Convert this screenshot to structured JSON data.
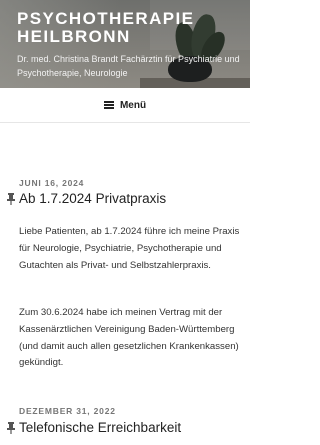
{
  "site": {
    "title": "PSYCHOTHERAPIE HEILBRONN",
    "description": "Dr. med. Christina Brandt Fachärztin für Psychiatrie und Psychotherapie, Neurologie"
  },
  "nav": {
    "menu_label": "Menü"
  },
  "posts": [
    {
      "date": "JUNI 16, 2024",
      "title": "Ab 1.7.2024 Privatpraxis",
      "paragraphs": [
        "Liebe Patienten, ab 1.7.2024 führe ich meine Praxis für Neurologie, Psychiatrie, Psychotherapie und Gutachten als Privat- und Selbstzahlerpraxis.",
        "Zum 30.6.2024 habe ich meinen Vertrag mit der Kassenärztlichen Vereinigung Baden-Württemberg (und damit auch allen gesetzlichen Krankenkassen) gekündigt."
      ]
    },
    {
      "date": "DEZEMBER 31, 2022",
      "title": "Telefonische Erreichbarkeit"
    }
  ],
  "icons": {
    "pin": "pushpin-icon",
    "menu": "hamburger-menu-icon"
  }
}
